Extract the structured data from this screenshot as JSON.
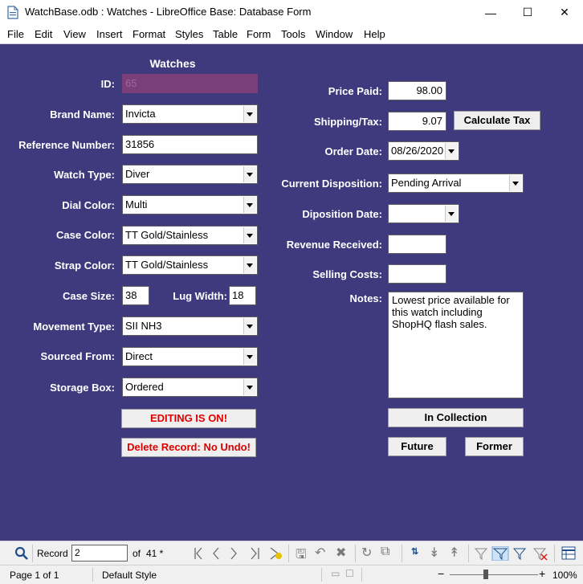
{
  "window": {
    "title": "WatchBase.odb : Watches - LibreOffice Base: Database Form",
    "minimize_glyph": "—",
    "maximize_glyph": "☐",
    "close_glyph": "✕"
  },
  "menubar": [
    "File",
    "Edit",
    "View",
    "Insert",
    "Format",
    "Styles",
    "Table",
    "Form",
    "Tools",
    "Window",
    "Help"
  ],
  "form": {
    "heading": "Watches",
    "left": {
      "id_label": "ID:",
      "id_value": "65",
      "brand_label": "Brand Name:",
      "brand_value": "Invicta",
      "ref_label": "Reference Number:",
      "ref_value": "31856",
      "type_label": "Watch Type:",
      "type_value": "Diver",
      "dial_label": "Dial Color:",
      "dial_value": "Multi",
      "case_label": "Case Color:",
      "case_value": "TT Gold/Stainless",
      "strap_label": "Strap Color:",
      "strap_value": "TT Gold/Stainless",
      "size_label": "Case Size:",
      "size_value": "38",
      "lug_label": "Lug Width:",
      "lug_value": "18",
      "movement_label": "Movement Type:",
      "movement_value": "SII NH3",
      "sourced_label": "Sourced From:",
      "sourced_value": "Direct",
      "storage_label": "Storage Box:",
      "storage_value": "Ordered",
      "editing_button": "EDITING IS ON!",
      "delete_button": "Delete Record: No Undo!"
    },
    "right": {
      "price_label": "Price Paid:",
      "price_value": "98.00",
      "ship_label": "Shipping/Tax:",
      "ship_value": "9.07",
      "calc_button": "Calculate Tax",
      "order_label": "Order Date:",
      "order_value": "08/26/2020",
      "disp_label": "Current Disposition:",
      "disp_value": "Pending Arrival",
      "dispdate_label": "Diposition Date:",
      "dispdate_value": "",
      "revenue_label": "Revenue Received:",
      "revenue_value": "",
      "selling_label": "Selling Costs:",
      "selling_value": "",
      "notes_label": "Notes:",
      "notes_value": "Lowest price available for this watch including ShopHQ flash sales.",
      "collection_button": "In Collection",
      "future_button": "Future",
      "former_button": "Former"
    },
    "colors": {
      "background": "#3f3a7e",
      "id_field": "#7a3f7a",
      "warning_text": "#e00000"
    }
  },
  "navbar": {
    "record_label": "Record",
    "record_value": "2",
    "of_label": "of",
    "total": "41 *"
  },
  "statusbar": {
    "page": "Page 1 of 1",
    "style": "Default Style",
    "zoom": "100%",
    "zoom_minus": "−",
    "zoom_plus": "+"
  }
}
